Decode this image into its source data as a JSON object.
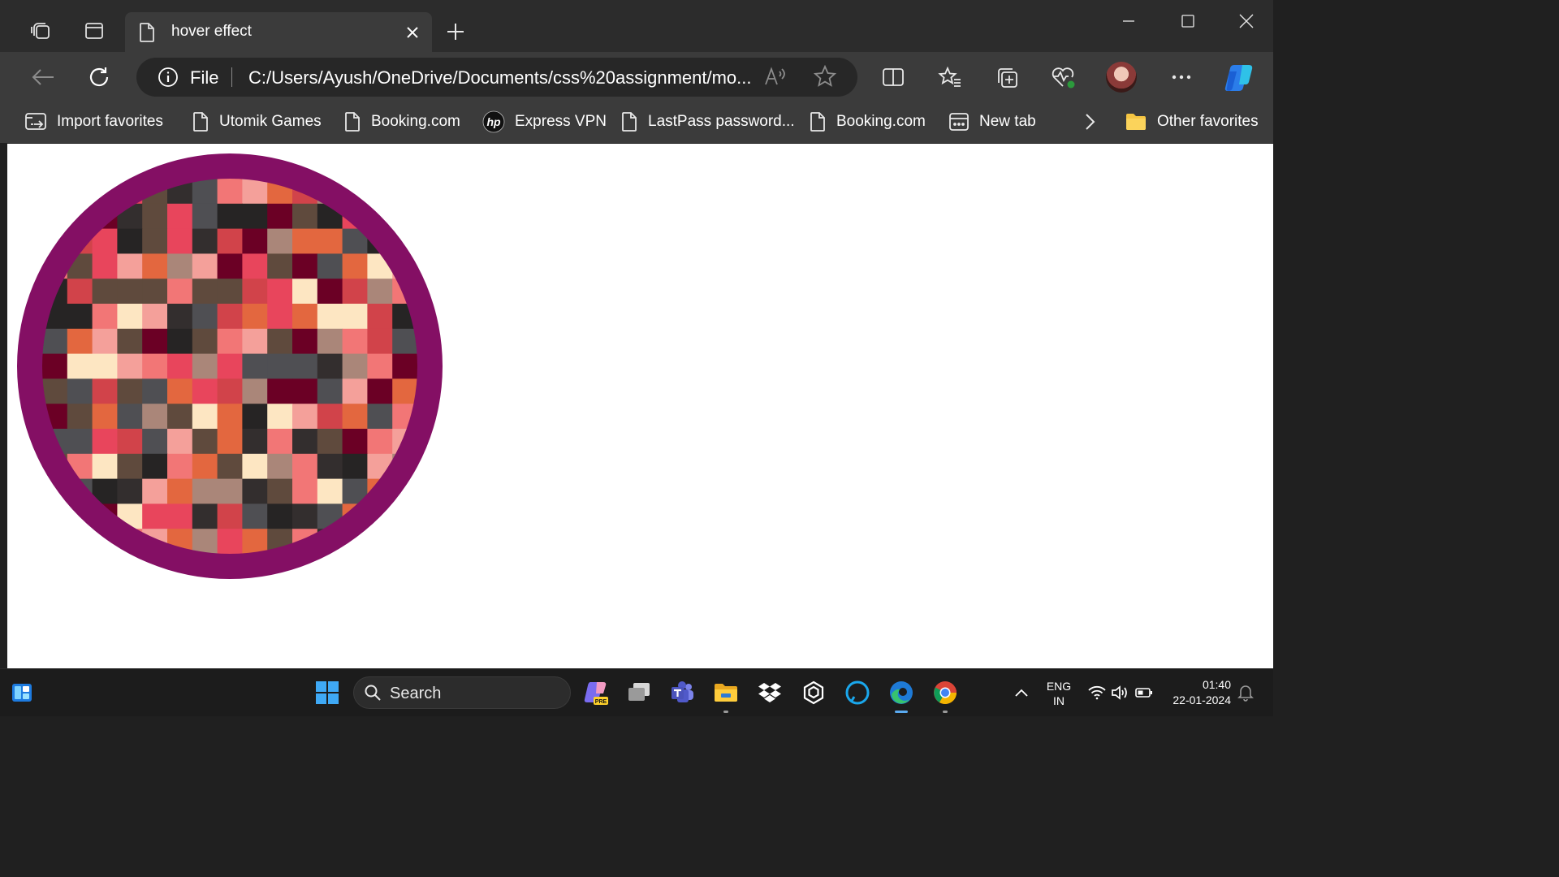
{
  "browser": {
    "tab": {
      "title": "hover effect"
    },
    "address": {
      "scheme": "File",
      "url": "C:/Users/Ayush/OneDrive/Documents/css%20assignment/mo..."
    },
    "favorites": [
      {
        "label": "Import favorites",
        "icon": "import-favorites-icon"
      },
      {
        "label": "Utomik Games",
        "icon": "page-icon"
      },
      {
        "label": "Booking.com",
        "icon": "page-icon"
      },
      {
        "label": "Express VPN",
        "icon": "hp-logo-icon"
      },
      {
        "label": "LastPass password...",
        "icon": "page-icon"
      },
      {
        "label": "Booking.com",
        "icon": "page-icon"
      },
      {
        "label": "New tab",
        "icon": "new-tab-page-icon"
      },
      {
        "label": "Other favorites",
        "icon": "folder-icon"
      }
    ]
  },
  "page": {
    "mosaic_colors": [
      "#4f4f53",
      "#6b0025",
      "#e8455c",
      "#d1434a",
      "#e3673f",
      "#5f4a3d",
      "#332e2e",
      "#f4a09a",
      "#fde6c2",
      "#aa8679",
      "#f27676",
      "#262424"
    ],
    "border_color": "#840f64"
  },
  "taskbar": {
    "search_placeholder": "Search",
    "language": [
      "ENG",
      "IN"
    ],
    "time": "01:40",
    "date": "22-01-2024"
  },
  "colors": {
    "titlebar": "#2c2c2c",
    "toolbar": "#3b3b3b",
    "taskbar": "#1c1c1c",
    "accent": "#5aaaf0"
  }
}
